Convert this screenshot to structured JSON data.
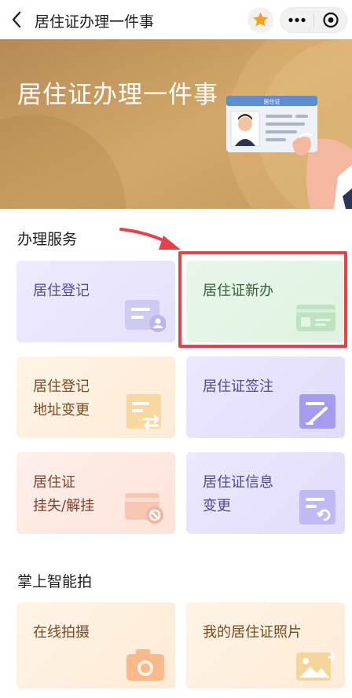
{
  "header": {
    "title": "居住证办理一件事"
  },
  "banner": {
    "title": "居住证办理一件事",
    "card_text": "居住证"
  },
  "sections": {
    "services": {
      "title": "办理服务"
    },
    "smart": {
      "title": "掌上智能拍"
    }
  },
  "cards": {
    "reg": {
      "line1": "居住登记"
    },
    "new": {
      "line1": "居住证新办"
    },
    "addr": {
      "line1": "居住登记",
      "line2": "地址变更"
    },
    "endorse": {
      "line1": "居住证签注"
    },
    "loss": {
      "line1": "居住证",
      "line2": "挂失/解挂"
    },
    "info": {
      "line1": "居住证信息",
      "line2": "变更"
    },
    "photo_online": {
      "line1": "在线拍摄"
    },
    "my_photo": {
      "line1": "我的居住证照片"
    }
  },
  "colors": {
    "highlight": "#e8404b",
    "star": "#f7a21b",
    "banner": "#c99a5d"
  },
  "icons": {
    "back": "chevron-left-icon",
    "star": "star-icon",
    "more": "more-dots-icon",
    "close": "target-circle-icon"
  }
}
